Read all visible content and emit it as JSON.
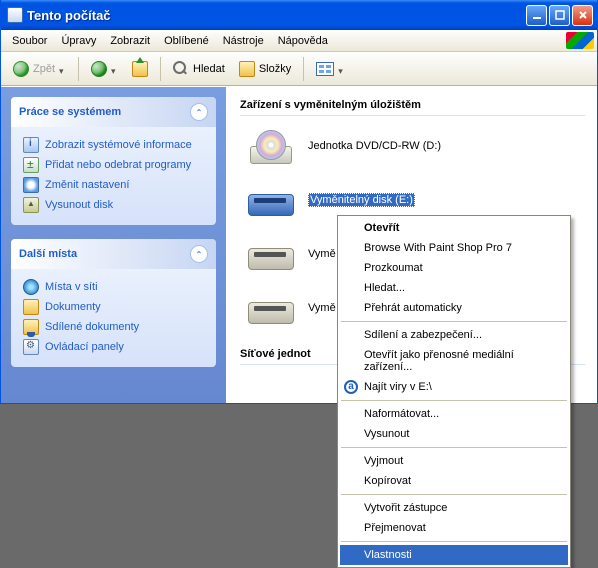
{
  "window": {
    "title": "Tento počítač"
  },
  "menubar": {
    "file": "Soubor",
    "edit": "Úpravy",
    "view": "Zobrazit",
    "favorites": "Oblíbené",
    "tools": "Nástroje",
    "help": "Nápověda"
  },
  "toolbar": {
    "back": "Zpět",
    "search": "Hledat",
    "folders": "Složky"
  },
  "sidebar": {
    "box1": {
      "title": "Práce se systémem",
      "items": [
        {
          "icon": "sysinfo",
          "label": "Zobrazit systémové informace"
        },
        {
          "icon": "programs",
          "label": "Přidat nebo odebrat programy"
        },
        {
          "icon": "settings",
          "label": "Změnit nastavení"
        },
        {
          "icon": "eject",
          "label": "Vysunout disk"
        }
      ]
    },
    "box2": {
      "title": "Další místa",
      "items": [
        {
          "icon": "network",
          "label": "Místa v síti"
        },
        {
          "icon": "docs",
          "label": "Dokumenty"
        },
        {
          "icon": "shared",
          "label": "Sdílené dokumenty"
        },
        {
          "icon": "cpl",
          "label": "Ovládací panely"
        }
      ]
    }
  },
  "main": {
    "section1_title": "Zařízení s vyměnitelným úložištěm",
    "devices": [
      {
        "label": "Jednotka DVD/CD-RW (D:)"
      },
      {
        "label": "Vyměnitelný disk (E:)"
      },
      {
        "label": "Vymě"
      },
      {
        "label": "Vymě"
      }
    ],
    "section2_title": "Síťové jednot"
  },
  "context_menu": {
    "open": "Otevřít",
    "browse": "Browse With Paint Shop Pro 7",
    "explore": "Prozkoumat",
    "search": "Hledat...",
    "autoplay": "Přehrát automaticky",
    "sharing": "Sdílení a zabezpečení...",
    "portable": "Otevřít jako přenosné mediální zařízení...",
    "avast": "Najít viry v E:\\",
    "format": "Naformátovat...",
    "eject": "Vysunout",
    "cut": "Vyjmout",
    "copy": "Kopírovat",
    "shortcut": "Vytvořit zástupce",
    "rename": "Přejmenovat",
    "properties": "Vlastnosti"
  }
}
